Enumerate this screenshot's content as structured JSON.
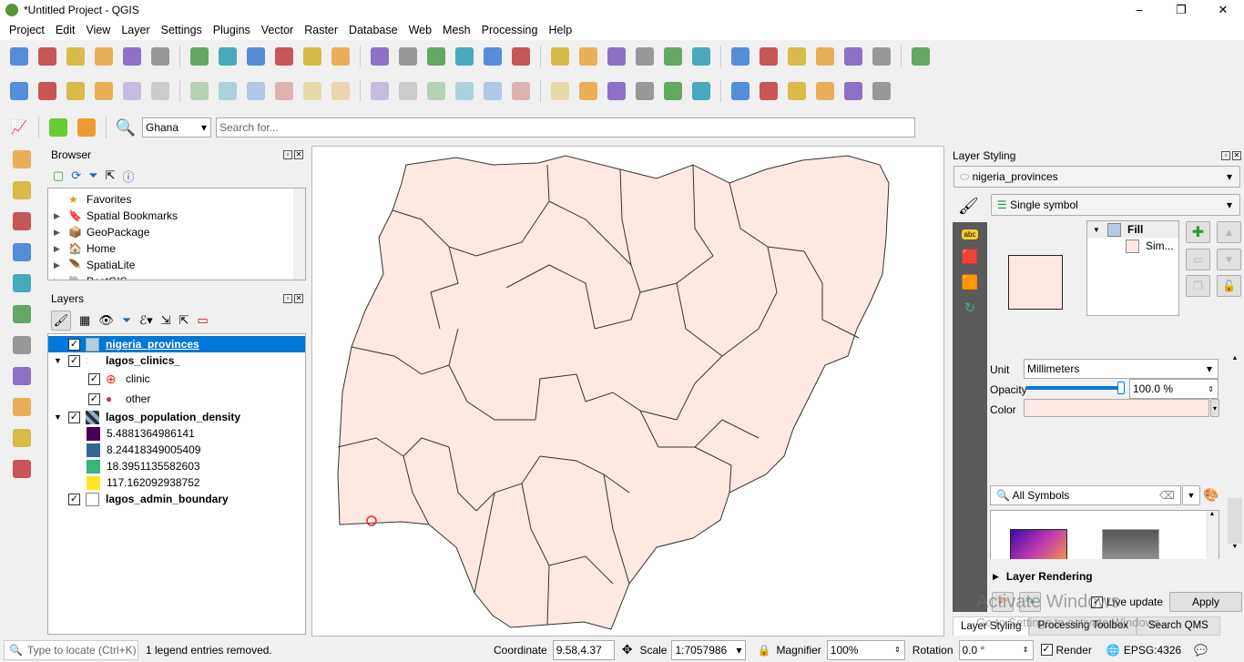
{
  "window": {
    "title": "*Untitled Project - QGIS",
    "controls": [
      "–",
      "❐",
      "✕"
    ]
  },
  "menu": [
    "Project",
    "Edit",
    "View",
    "Layer",
    "Settings",
    "Plugins",
    "Vector",
    "Raster",
    "Database",
    "Web",
    "Mesh",
    "Processing",
    "Help"
  ],
  "toolbar1": [
    "new-project",
    "open-project",
    "save-project",
    "new-print-layout",
    "layout-manager",
    "style-manager",
    "pan",
    "pan-to-selection",
    "zoom-in",
    "zoom-out",
    "zoom-full",
    "zoom-to-selection",
    "zoom-to-layer",
    "zoom-native",
    "zoom-last",
    "zoom-next",
    "new-bookmark",
    "show-bookmarks",
    "refresh",
    "identify",
    "action",
    "select-features",
    "deselect",
    "attribute-table",
    "field-calculator",
    "statistics",
    "processing-toolbox",
    "sum",
    "measure",
    "map-tips",
    "annotation"
  ],
  "toolbar2": [
    "add-vector",
    "add-raster",
    "digitize",
    "edit-pencil",
    "save-edits",
    "add-feature",
    "vertex-tool",
    "delete",
    "cut",
    "copy",
    "paste",
    "undo",
    "redo",
    "label-abc",
    "diagram",
    "label-pin",
    "label-show",
    "label-move",
    "label-rotate",
    "label-change",
    "quickmapservices",
    "qms-search",
    "python",
    "plugin-red",
    "layers-green",
    "globe",
    "butterfly",
    "help",
    "georef",
    "refresh-green"
  ],
  "toolbar3": {
    "icons": [
      "profile-tool",
      "search-green",
      "locate-tool"
    ],
    "locator_icon": "search-icon",
    "region": "Ghana",
    "search_placeholder": "Search for..."
  },
  "left_toolbar": [
    "digitize-add",
    "raster-add",
    "mesh-add",
    "delimited-add",
    "spatialite-add",
    "virtual-add",
    "postgis-add",
    "wms-add",
    "wfs-add",
    "wcs-add",
    "geonode-add"
  ],
  "browser": {
    "title": "Browser",
    "items": [
      "Favorites",
      "Spatial Bookmarks",
      "GeoPackage",
      "Home",
      "SpatiaLite",
      "PostGIS"
    ]
  },
  "layers": {
    "title": "Layers",
    "items": [
      {
        "name": "nigeria_provinces",
        "selected": true
      },
      {
        "name": "lagos_clinics_",
        "children": [
          "clinic",
          "other"
        ]
      },
      {
        "name": "lagos_population_density",
        "legend": [
          {
            "label": "5.4881364986141",
            "color": "#440154"
          },
          {
            "label": "8.24418349005409",
            "color": "#31688e"
          },
          {
            "label": "18.3951135582603",
            "color": "#35b779"
          },
          {
            "label": "117.162092938752",
            "color": "#fde725"
          }
        ]
      },
      {
        "name": "lagos_admin_boundary"
      }
    ]
  },
  "map": {
    "fill": "#fde9e1",
    "stroke": "#333333"
  },
  "styling": {
    "title": "Layer Styling",
    "layer": "nigeria_provinces",
    "renderer": "Single symbol",
    "tree_root": "Fill",
    "tree_child": "Sim...",
    "unit_label": "Unit",
    "unit": "Millimeters",
    "opacity_label": "Opacity",
    "opacity": "100.0 %",
    "opacity_value": 100,
    "color_label": "Color",
    "color": "#fde9e1",
    "symbols_filter": "All Symbols",
    "layer_rendering": "Layer Rendering",
    "live_update": "Live update",
    "apply": "Apply",
    "tabs": [
      "Layer Styling",
      "Processing Toolbox",
      "Search QMS"
    ],
    "watermark1": "Activate Windows",
    "watermark2": "Go to Settings to activate Windows."
  },
  "status": {
    "locate_placeholder": "Type to locate (Ctrl+K)",
    "message": "1 legend entries removed.",
    "coordinate_label": "Coordinate",
    "coordinate": "9.58,4.37",
    "scale_label": "Scale",
    "scale": "1:7057986",
    "magnifier_label": "Magnifier",
    "magnifier": "100%",
    "rotation_label": "Rotation",
    "rotation": "0.0 °",
    "render_label": "Render",
    "crs": "EPSG:4326"
  }
}
